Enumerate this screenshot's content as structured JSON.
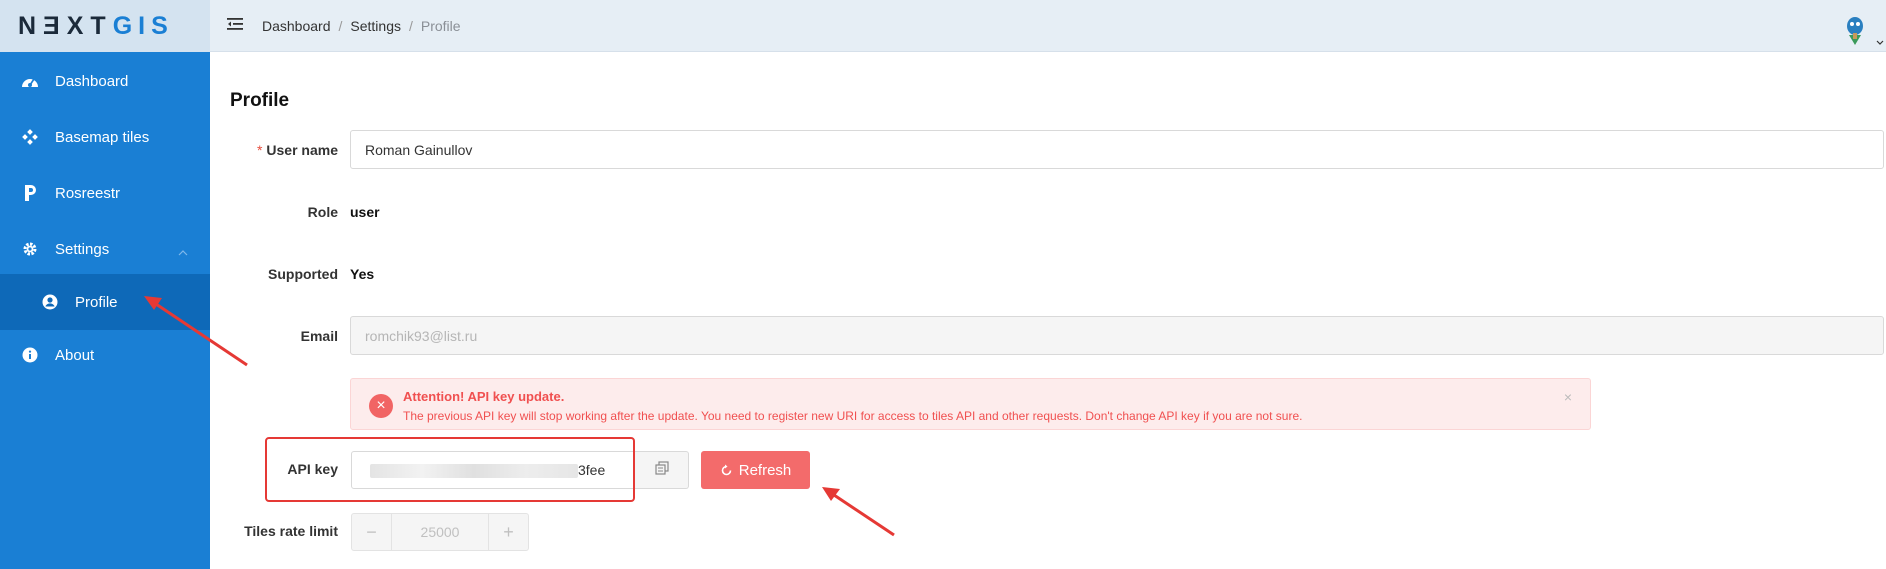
{
  "logo": {
    "part1": "NƎXT",
    "part2": "GIS"
  },
  "sidebar": {
    "items": [
      {
        "label": "Dashboard",
        "icon": "dashboard-icon"
      },
      {
        "label": "Basemap tiles",
        "icon": "tiles-icon"
      },
      {
        "label": "Rosreestr",
        "icon": "rosreestr-icon"
      },
      {
        "label": "Settings",
        "icon": "gear-icon"
      },
      {
        "label": "Profile",
        "icon": "user-circle-icon"
      },
      {
        "label": "About",
        "icon": "info-icon"
      }
    ]
  },
  "breadcrumb": {
    "items": [
      "Dashboard",
      "Settings",
      "Profile"
    ],
    "separator": "/"
  },
  "page": {
    "title": "Profile"
  },
  "form": {
    "username": {
      "label": "User name",
      "required_mark": "*",
      "value": "Roman Gainullov"
    },
    "role": {
      "label": "Role",
      "value": "user"
    },
    "supported": {
      "label": "Supported",
      "value": "Yes"
    },
    "email": {
      "label": "Email",
      "value": "romchik93@list.ru"
    },
    "api_key": {
      "label": "API key",
      "visible_suffix": "3fee"
    },
    "tiles_rate": {
      "label": "Tiles rate limit",
      "value": "25000",
      "minus": "−",
      "plus": "+"
    }
  },
  "alert": {
    "title": "Attention! API key update.",
    "description": "The previous API key will stop working after the update. You need to register new URI for access to tiles API and other requests. Don't change API key if you are not sure.",
    "close": "×",
    "icon": "×"
  },
  "buttons": {
    "refresh": "Refresh"
  },
  "colors": {
    "sidebar": "#1a7fd4",
    "sidebar_active": "#0e69b8",
    "header": "#e6eef5",
    "danger": "#f36b6b",
    "annotation": "#e53935"
  }
}
